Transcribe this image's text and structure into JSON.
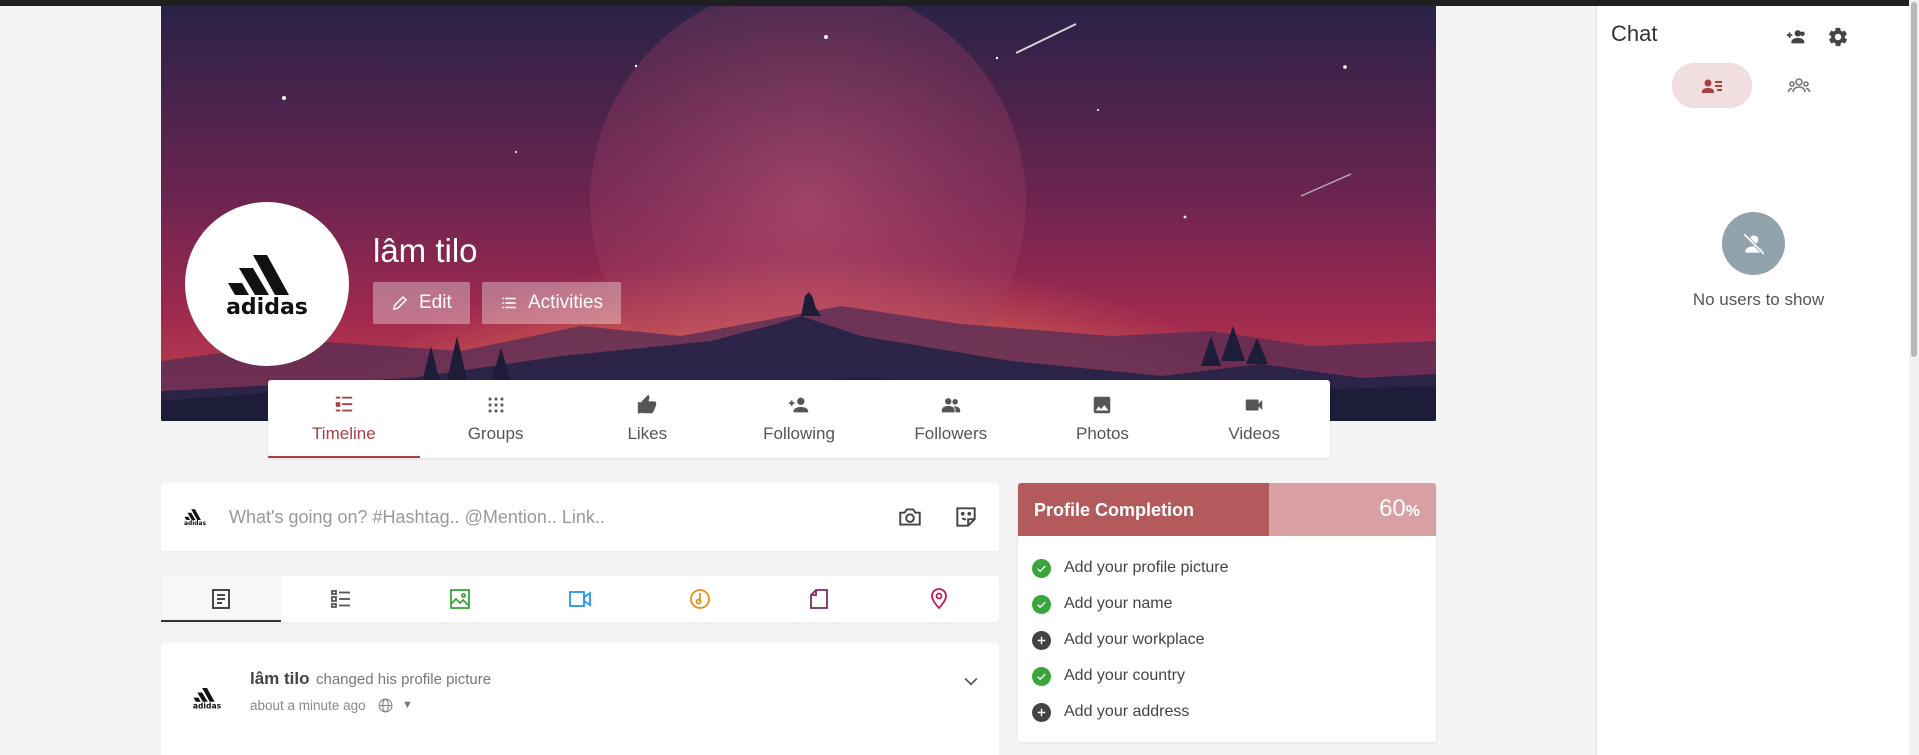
{
  "profile": {
    "name": "lâm tilo",
    "logo_text": "adidas",
    "edit_label": "Edit",
    "activities_label": "Activities"
  },
  "tabs": [
    {
      "label": "Timeline",
      "icon": "timeline-icon",
      "active": true
    },
    {
      "label": "Groups",
      "icon": "groups-icon"
    },
    {
      "label": "Likes",
      "icon": "thumb-up-icon"
    },
    {
      "label": "Following",
      "icon": "person-add-icon"
    },
    {
      "label": "Followers",
      "icon": "people-icon"
    },
    {
      "label": "Photos",
      "icon": "image-icon"
    },
    {
      "label": "Videos",
      "icon": "videocam-icon"
    }
  ],
  "composer": {
    "placeholder": "What's going on? #Hashtag.. @Mention.. Link..",
    "icons": [
      "camera-icon",
      "sticker-icon"
    ]
  },
  "filters": [
    {
      "icon": "article-icon",
      "color": "#333333",
      "active": true
    },
    {
      "icon": "list-icon",
      "color": "#555555"
    },
    {
      "icon": "image-icon",
      "color": "#3aa53c"
    },
    {
      "icon": "video-icon",
      "color": "#2196f3"
    },
    {
      "icon": "music-icon",
      "color": "#e69016"
    },
    {
      "icon": "file-icon",
      "color": "#7b2d6b"
    },
    {
      "icon": "location-icon",
      "color": "#c2185b"
    }
  ],
  "post": {
    "author": "lâm tilo",
    "action": "changed his profile picture",
    "time": "about a minute ago",
    "privacy_icon": "globe-icon"
  },
  "completion": {
    "title": "Profile Completion",
    "percent_value": "60",
    "percent_sign": "%",
    "progress": 0.6,
    "items": [
      {
        "label": "Add your profile picture",
        "done": true
      },
      {
        "label": "Add your name",
        "done": true
      },
      {
        "label": "Add your workplace",
        "done": false
      },
      {
        "label": "Add your country",
        "done": true
      },
      {
        "label": "Add your address",
        "done": false
      }
    ]
  },
  "chat": {
    "title": "Chat",
    "empty_text": "No users to show"
  },
  "colors": {
    "accent": "#a84142",
    "completion_fill": "#b35a5c",
    "completion_track": "#d8a0a2",
    "done_green": "#3aa53c"
  }
}
